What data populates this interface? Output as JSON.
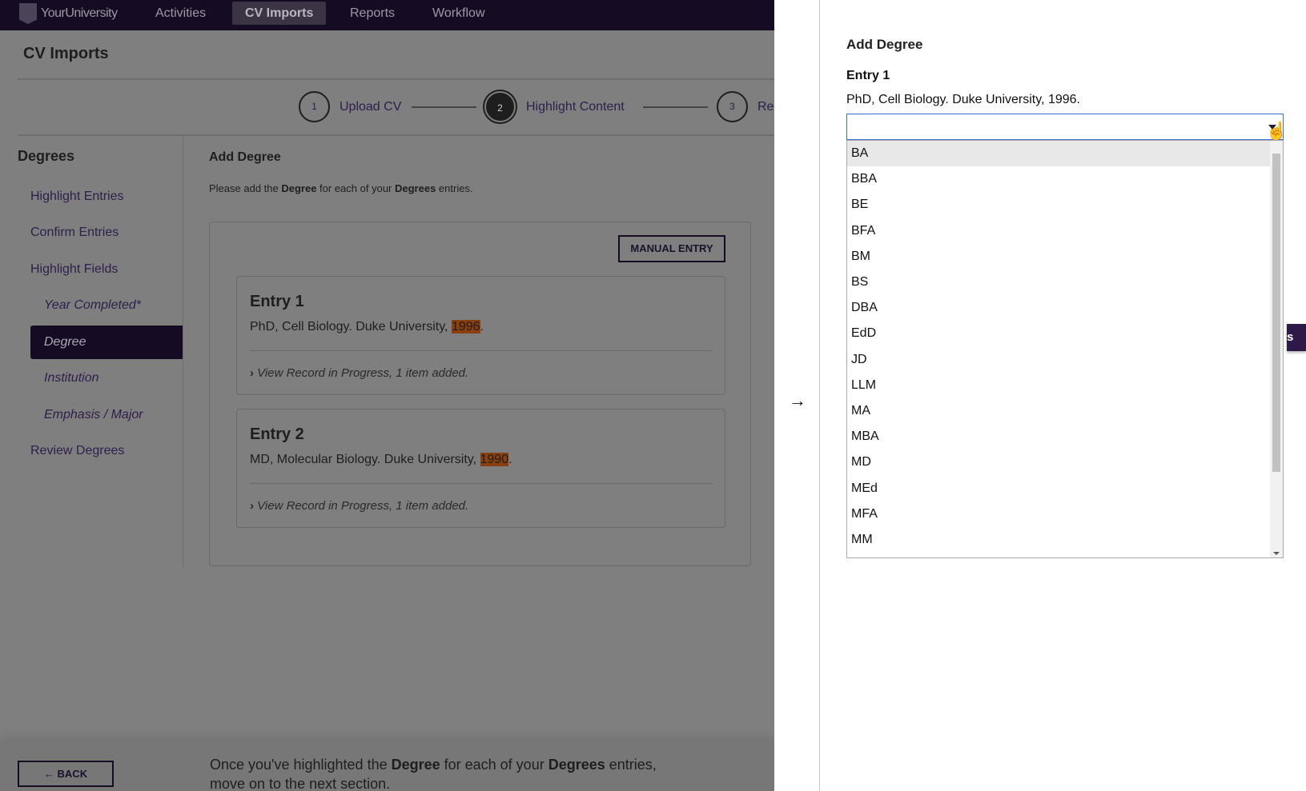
{
  "nav": {
    "brand": "YourUniversity",
    "items": [
      "Activities",
      "CV Imports",
      "Reports",
      "Workflow"
    ],
    "active": "CV Imports"
  },
  "page_title": "CV Imports",
  "stepper": [
    {
      "num": "1",
      "label": "Upload CV"
    },
    {
      "num": "2",
      "label": "Highlight Content"
    },
    {
      "num": "3",
      "label": "Re"
    }
  ],
  "sidebar": {
    "title": "Degrees",
    "items": [
      "Highlight Entries",
      "Confirm Entries",
      "Highlight Fields",
      "Year Completed*",
      "Degree",
      "Institution",
      "Emphasis / Major",
      "Review Degrees"
    ],
    "active": "Degree"
  },
  "main": {
    "title": "Add Degree",
    "desc_pre": "Please add the ",
    "desc_b1": "Degree",
    "desc_mid": " for each of your ",
    "desc_b2": "Degrees",
    "desc_post": " entries.",
    "manual_entry": "MANUAL ENTRY",
    "entries": [
      {
        "title": "Entry 1",
        "text": "PhD, Cell Biology. Duke University, ",
        "year": "1996",
        "record": "View Record in Progress, 1 item added."
      },
      {
        "title": "Entry 2",
        "text": "MD, Molecular Biology. Duke University, ",
        "year": "1990",
        "record": "View Record in Progress, 1 item added."
      }
    ]
  },
  "footer": {
    "back": "BACK",
    "msg_pre": "Once you've highlighted the ",
    "msg_b1": "Degree",
    "msg_mid": " for each of your ",
    "msg_b2": "Degrees",
    "msg_post": " entries,",
    "msg_line2": "move on to the next section."
  },
  "panel": {
    "title": "Add Degree",
    "entry_title": "Entry 1",
    "entry_text": "PhD, Cell Biology. Duke University, 1996.",
    "select_value": "",
    "options": [
      "BA",
      "BBA",
      "BE",
      "BFA",
      "BM",
      "BS",
      "DBA",
      "EdD",
      "JD",
      "LLM",
      "MA",
      "MBA",
      "MD",
      "MEd",
      "MFA",
      "MM"
    ],
    "hovered_option": "BA",
    "partial_button": "s"
  },
  "colors": {
    "nav_bg": "#150c24",
    "highlight": "#8a3f0e",
    "accent": "#2d1f4a"
  }
}
